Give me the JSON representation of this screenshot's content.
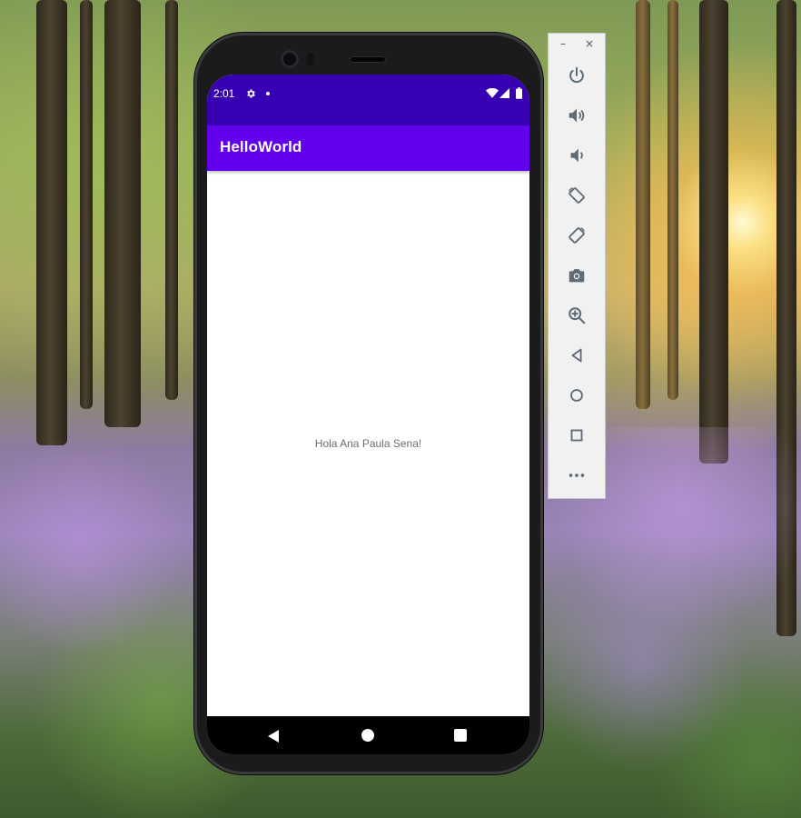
{
  "status_bar": {
    "time": "2:01"
  },
  "app": {
    "title": "HelloWorld",
    "message": "Hola Ana Paula Sena!"
  },
  "toolbar": {
    "minimize_label": "–",
    "close_label": "×",
    "buttons": [
      {
        "name": "power-icon"
      },
      {
        "name": "volume-up-icon"
      },
      {
        "name": "volume-down-icon"
      },
      {
        "name": "rotate-left-icon"
      },
      {
        "name": "rotate-right-icon"
      },
      {
        "name": "camera-icon"
      },
      {
        "name": "zoom-icon"
      },
      {
        "name": "back-icon"
      },
      {
        "name": "home-icon"
      },
      {
        "name": "overview-icon"
      },
      {
        "name": "more-icon"
      }
    ]
  },
  "colors": {
    "status_bar": "#3700b3",
    "app_bar": "#6200ee",
    "toolbar_icon": "#5f6b75"
  }
}
